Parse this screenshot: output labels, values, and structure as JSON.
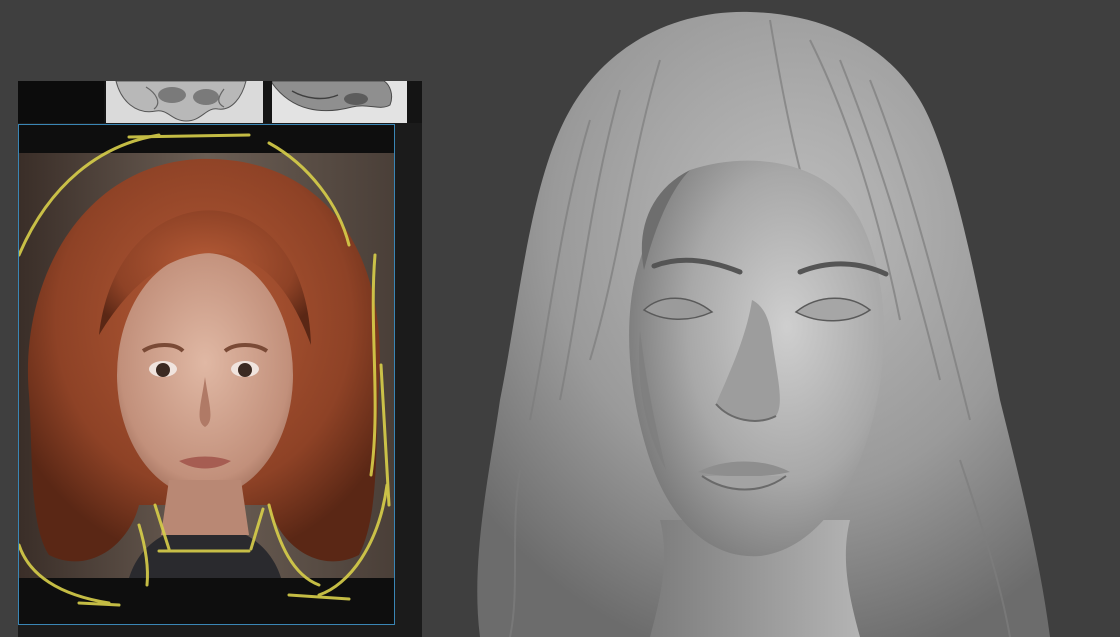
{
  "reference_board": {
    "thumbnails": [
      {
        "caption": "",
        "icon": "dark-thumbnail"
      },
      {
        "caption": "",
        "icon": "skull-sculpt-thumbnail"
      },
      {
        "caption": "",
        "icon": "face-sculpt-thumbnail"
      }
    ]
  },
  "colors": {
    "viewport_bg": "#3f3f3f",
    "board_bg": "#1b1b1b",
    "selection_border": "#3a86b5",
    "guide_lines": "#d8cf4a",
    "clay": "#a9a9a9"
  },
  "icons": {
    "reference_photo": "portrait-photo",
    "sculpt": "clay-head-sculpt"
  }
}
